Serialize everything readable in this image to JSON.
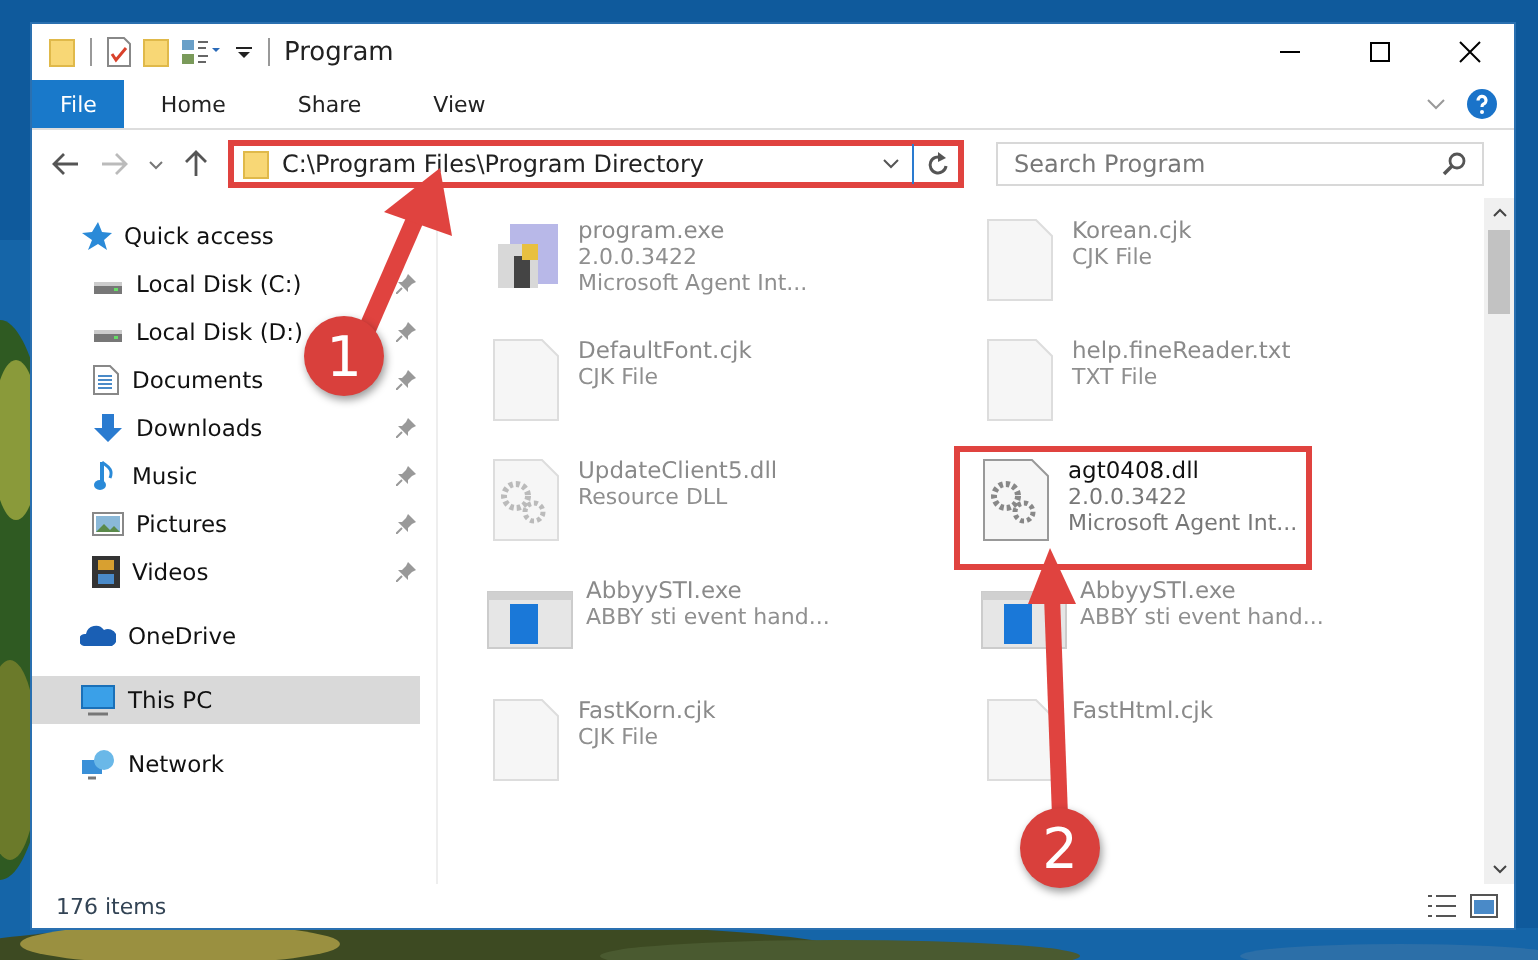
{
  "window": {
    "title": "Program"
  },
  "ribbon": {
    "tabs": [
      {
        "label": "File",
        "selected": true
      },
      {
        "label": "Home",
        "selected": false
      },
      {
        "label": "Share",
        "selected": false
      },
      {
        "label": "View",
        "selected": false
      }
    ]
  },
  "address_bar": {
    "path": "C:\\Program Files\\Program Directory",
    "highlighted": true
  },
  "search": {
    "placeholder": "Search Program"
  },
  "sidebar": {
    "items": [
      {
        "label": "Quick access",
        "kind": "star",
        "selected": false,
        "children": [
          {
            "label": "Local Disk (C:)",
            "kind": "disk",
            "pinned": true
          },
          {
            "label": "Local Disk (D:)",
            "kind": "disk",
            "pinned": true
          },
          {
            "label": "Documents",
            "kind": "doc",
            "pinned": true
          },
          {
            "label": "Downloads",
            "kind": "download",
            "pinned": true
          },
          {
            "label": "Music",
            "kind": "music",
            "pinned": true
          },
          {
            "label": "Pictures",
            "kind": "pictures",
            "pinned": true
          },
          {
            "label": "Videos",
            "kind": "videos",
            "pinned": true
          }
        ]
      },
      {
        "label": "OneDrive",
        "kind": "cloud",
        "selected": false
      },
      {
        "label": "This PC",
        "kind": "pc",
        "selected": true
      },
      {
        "label": "Network",
        "kind": "network",
        "selected": false
      }
    ]
  },
  "files": [
    {
      "name": "program.exe",
      "kind": "exe",
      "details": [
        "2.0.0.3422",
        "Microsoft Agent Int..."
      ],
      "highlighted": false
    },
    {
      "name": "Korean.cjk",
      "kind": "blank",
      "details": [
        "CJK File"
      ],
      "highlighted": false
    },
    {
      "name": "DefaultFont.cjk",
      "kind": "blank",
      "details": [
        "CJK File"
      ],
      "highlighted": false
    },
    {
      "name": "help.fineReader.txt",
      "kind": "blank",
      "details": [
        "TXT File"
      ],
      "highlighted": false
    },
    {
      "name": "UpdateClient5.dll",
      "kind": "dll",
      "details": [
        "Resource DLL"
      ],
      "highlighted": false
    },
    {
      "name": "agt0408.dll",
      "kind": "dll",
      "details": [
        "2.0.0.3422",
        "Microsoft Agent Int..."
      ],
      "highlighted": true
    },
    {
      "name": "AbbyySTI.exe",
      "kind": "app",
      "details": [
        "ABBY sti event hand..."
      ],
      "highlighted": false
    },
    {
      "name": "AbbyySTI.exe",
      "kind": "app",
      "details": [
        "ABBY sti event hand..."
      ],
      "highlighted": false
    },
    {
      "name": "FastKorn.cjk",
      "kind": "blank",
      "details": [
        "CJK File"
      ],
      "highlighted": false
    },
    {
      "name": "FastHtml.cjk",
      "kind": "blank",
      "highlighted": false
    }
  ],
  "status_bar": {
    "count": "176 items"
  },
  "callouts": [
    {
      "label": "1"
    },
    {
      "label": "2"
    }
  ]
}
